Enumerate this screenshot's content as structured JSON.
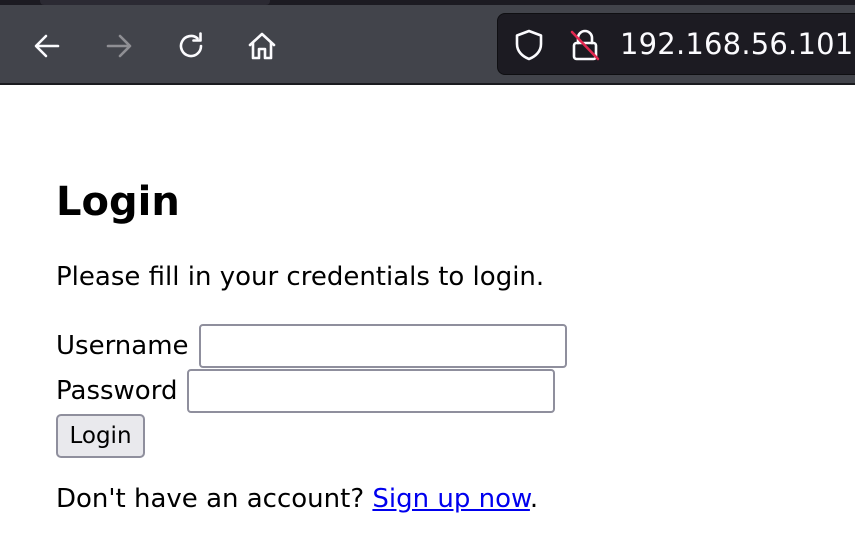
{
  "browser": {
    "url": "192.168.56.101",
    "icons": {
      "back": "arrow-left-icon",
      "forward": "arrow-right-icon",
      "reload": "reload-icon",
      "home": "home-icon",
      "tracking_protection": "shield-icon",
      "connection": "insecure-lock-icon"
    }
  },
  "login_page": {
    "title": "Login",
    "instructions": "Please fill in your credentials to login.",
    "username_label": "Username",
    "username_value": "",
    "password_label": "Password",
    "password_value": "",
    "submit_label": "Login",
    "signup_prompt": "Don't have an account? ",
    "signup_link_text": "Sign up now",
    "signup_suffix": "."
  },
  "colors": {
    "toolbar_bg": "#42444b",
    "urlbar_bg": "#1c1b22",
    "link": "#0000ee",
    "button_bg": "#e9e9ed",
    "input_border": "#8f8f9d"
  }
}
